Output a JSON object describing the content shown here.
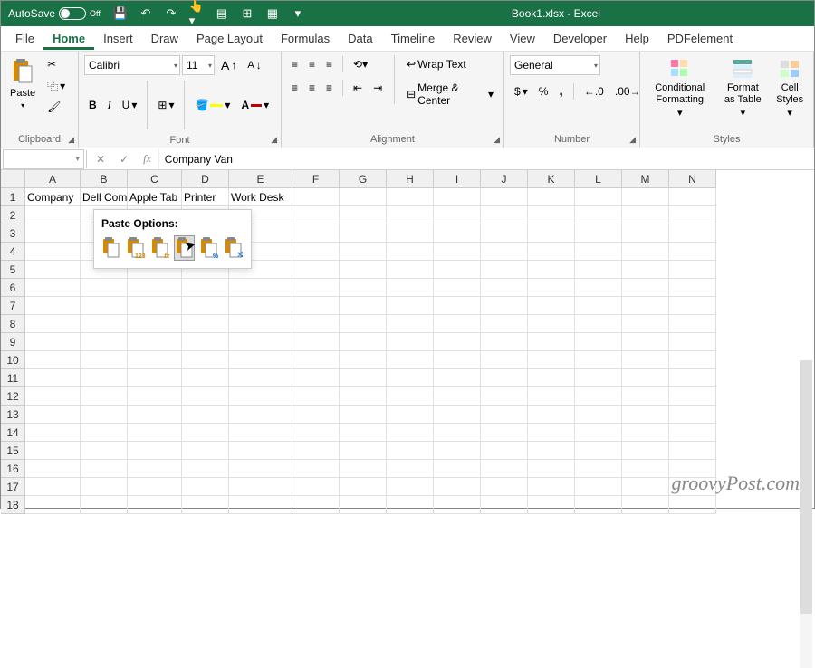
{
  "titlebar": {
    "autosave_label": "AutoSave",
    "autosave_state": "Off",
    "filename": "Book1.xlsx",
    "app": "Excel"
  },
  "menu": {
    "items": [
      "File",
      "Home",
      "Insert",
      "Draw",
      "Page Layout",
      "Formulas",
      "Data",
      "Timeline",
      "Review",
      "View",
      "Developer",
      "Help",
      "PDFelement"
    ],
    "active": "Home"
  },
  "ribbon": {
    "clipboard": {
      "label": "Clipboard",
      "paste": "Paste"
    },
    "font": {
      "label": "Font",
      "name": "Calibri",
      "size": "11",
      "bold": "B",
      "italic": "I",
      "underline": "U",
      "increase": "A",
      "decrease": "A"
    },
    "alignment": {
      "label": "Alignment",
      "wrap": "Wrap Text",
      "merge": "Merge & Center"
    },
    "number": {
      "label": "Number",
      "format": "General",
      "currency": "$",
      "percent": "%",
      "comma": ",",
      "inc_dec": ".0",
      "dec_dec": ".00"
    },
    "styles": {
      "label": "Styles",
      "conditional": "Conditional Formatting",
      "table": "Format as Table",
      "cell": "Cell Styles"
    }
  },
  "formula_bar": {
    "name_box": "",
    "value": "Company Van"
  },
  "columns": [
    "A",
    "B",
    "C",
    "D",
    "E",
    "F",
    "G",
    "H",
    "I",
    "J",
    "K",
    "L",
    "M",
    "N"
  ],
  "rows": [
    1,
    2,
    3,
    4,
    5,
    6,
    7,
    8,
    9,
    10,
    11,
    12,
    13,
    14,
    15,
    16,
    17,
    18
  ],
  "cells": {
    "A1": "Company",
    "B1": "Dell Comp",
    "C1": "Apple Tab",
    "D1": "Printer",
    "E1": "Work Desk"
  },
  "paste_popup": {
    "title": "Paste Options:",
    "options": [
      "paste",
      "values",
      "formulas",
      "transpose",
      "formatting",
      "link"
    ]
  },
  "watermark": "groovyPost.com"
}
